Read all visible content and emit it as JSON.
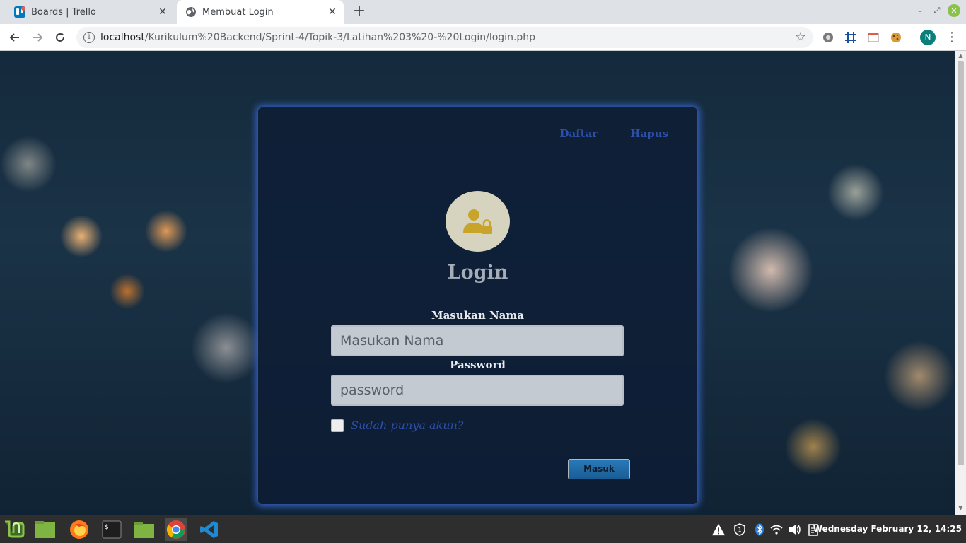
{
  "browser": {
    "tabs": [
      {
        "title": "Boards | Trello",
        "favicon": "trello-icon",
        "active": false
      },
      {
        "title": "Membuat Login",
        "favicon": "globe-icon",
        "active": true
      }
    ],
    "new_tab_label": "+",
    "url": {
      "host": "localhost",
      "path": "/Kurikulum%20Backend/Sprint-4/Topik-3/Latihan%203%20-%20Login/login.php"
    },
    "profile_initial": "N"
  },
  "page": {
    "nav_links": {
      "daftar": "Daftar",
      "hapus": "Hapus"
    },
    "title": "Login",
    "name_label": "Masukan Nama",
    "name_placeholder": "Masukan Nama",
    "password_label": "Password",
    "password_placeholder": "password",
    "remember_label": "Sudah punya akun?",
    "submit_label": "Masuk"
  },
  "taskbar": {
    "apps": [
      "mint-menu-icon",
      "files-icon",
      "firefox-icon",
      "terminal-icon",
      "folder-icon",
      "chrome-icon",
      "vscode-icon"
    ],
    "terminal_prompt": "$_",
    "clock": "Wednesday February 12, 14:25"
  },
  "colors": {
    "card_glow": "#3c6ee6",
    "link_blue": "#2e4fa8",
    "user_lock_icon": "#c9a42a",
    "button": "#1a5d95"
  }
}
